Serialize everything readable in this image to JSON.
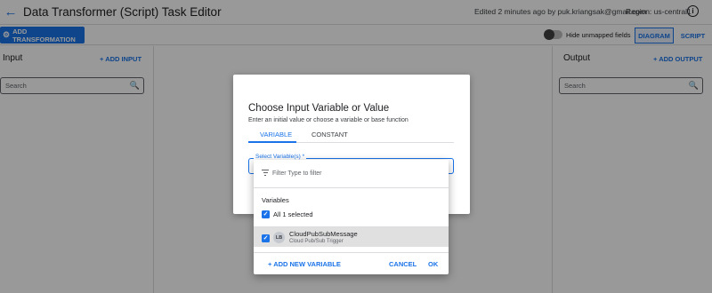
{
  "header": {
    "title": "Data Transformer (Script) Task Editor",
    "edited": "Edited 2 minutes ago by puk.kriangsak@gmail.com",
    "region": "Region: us-central1"
  },
  "toolbar": {
    "add_transformation": "ADD TRANSFORMATION",
    "hide_unmapped": "Hide unmapped fields",
    "diagram": "DIAGRAM",
    "script": "SCRIPT"
  },
  "input_panel": {
    "title": "Input",
    "add_label": "ADD INPUT",
    "search_placeholder": "Search"
  },
  "output_panel": {
    "title": "Output",
    "add_label": "ADD OUTPUT",
    "search_placeholder": "Search"
  },
  "dialog": {
    "title": "Choose Input Variable or Value",
    "subtitle": "Enter an initial value or choose a variable or base function",
    "tabs": [
      "VARIABLE",
      "CONSTANT"
    ],
    "select_label": "Select Variable(s) *"
  },
  "dropdown": {
    "filter_placeholder": "Filter Type to filter",
    "group_label": "Variables",
    "all_selected": "All 1 selected",
    "items": [
      {
        "avatar": "LB",
        "name": "CloudPubSubMessage",
        "description": "Cloud Pub/Sub Trigger"
      }
    ],
    "add_new": "ADD NEW VARIABLE",
    "cancel": "CANCEL",
    "ok": "OK"
  },
  "icons": {
    "back": "arrow-back-icon",
    "info": "info-icon",
    "gear": "gear-icon",
    "search": "search-icon",
    "filter": "filter-icon",
    "check": "check-icon"
  },
  "colors": {
    "accent": "#1a73e8"
  }
}
